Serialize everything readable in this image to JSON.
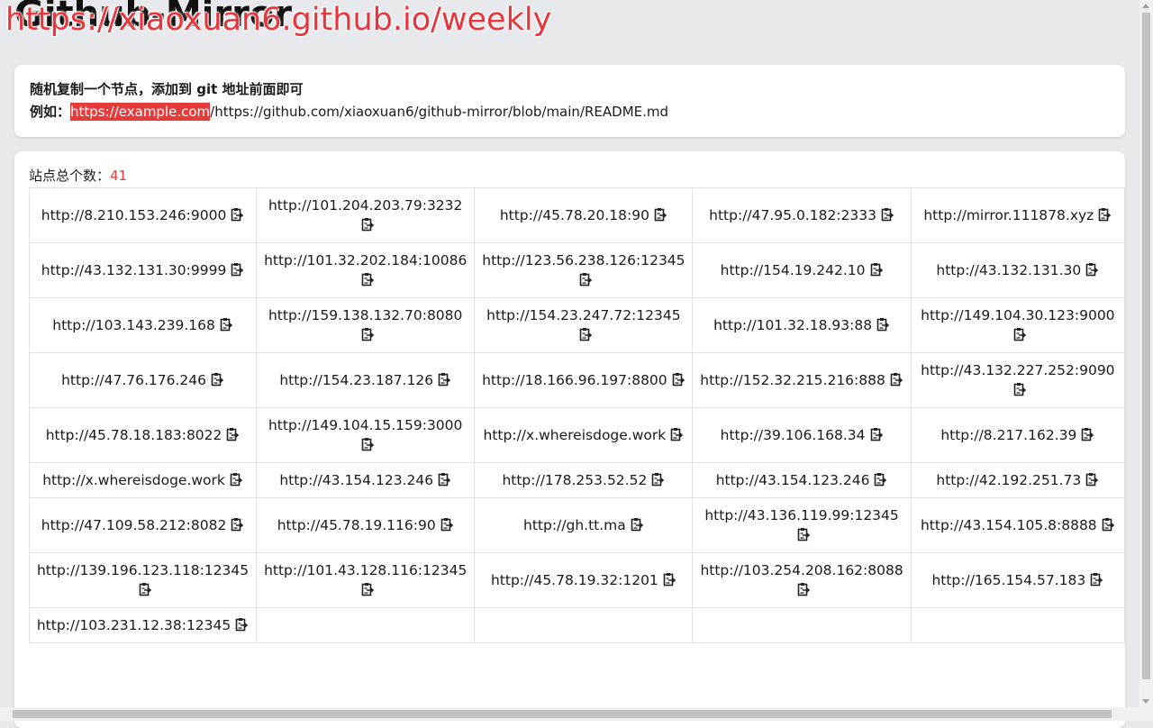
{
  "page": {
    "title": "Github-Mirror",
    "overlay_url": "https://xiaoxuan6.github.io/weekly"
  },
  "info": {
    "line1": "随机复制一个节点，添加到 git 地址前面即可",
    "example_label": "例如：",
    "example_highlight": "https://example.com",
    "example_rest": "/https://github.com/xiaoxuan6/github-mirror/blob/main/README.md"
  },
  "list": {
    "count_label": "站点总个数：",
    "count": "41",
    "icon": "copy-icon",
    "rows": [
      [
        "http://8.210.153.246:9000",
        "http://101.204.203.79:3232",
        "http://45.78.20.18:90",
        "http://47.95.0.182:2333",
        "http://mirror.111878.xyz"
      ],
      [
        "http://43.132.131.30:9999",
        "http://101.32.202.184:10086",
        "http://123.56.238.126:12345",
        "http://154.19.242.10",
        "http://43.132.131.30"
      ],
      [
        "http://103.143.239.168",
        "http://159.138.132.70:8080",
        "http://154.23.247.72:12345",
        "http://101.32.18.93:88",
        "http://149.104.30.123:9000"
      ],
      [
        "http://47.76.176.246",
        "http://154.23.187.126",
        "http://18.166.96.197:8800",
        "http://152.32.215.216:888",
        "http://43.132.227.252:9090"
      ],
      [
        "http://45.78.18.183:8022",
        "http://149.104.15.159:3000",
        "http://x.whereisdoge.work",
        "http://39.106.168.34",
        "http://8.217.162.39"
      ],
      [
        "http://x.whereisdoge.work",
        "http://43.154.123.246",
        "http://178.253.52.52",
        "http://43.154.123.246",
        "http://42.192.251.73"
      ],
      [
        "http://47.109.58.212:8082",
        "http://45.78.19.116:90",
        "http://gh.tt.ma",
        "http://43.136.119.99:12345",
        "http://43.154.105.8:8888"
      ],
      [
        "http://139.196.123.118:12345",
        "http://101.43.128.116:12345",
        "http://45.78.19.32:1201",
        "http://103.254.208.162:8088",
        "http://165.154.57.183"
      ],
      [
        "http://103.231.12.38:12345"
      ]
    ]
  }
}
